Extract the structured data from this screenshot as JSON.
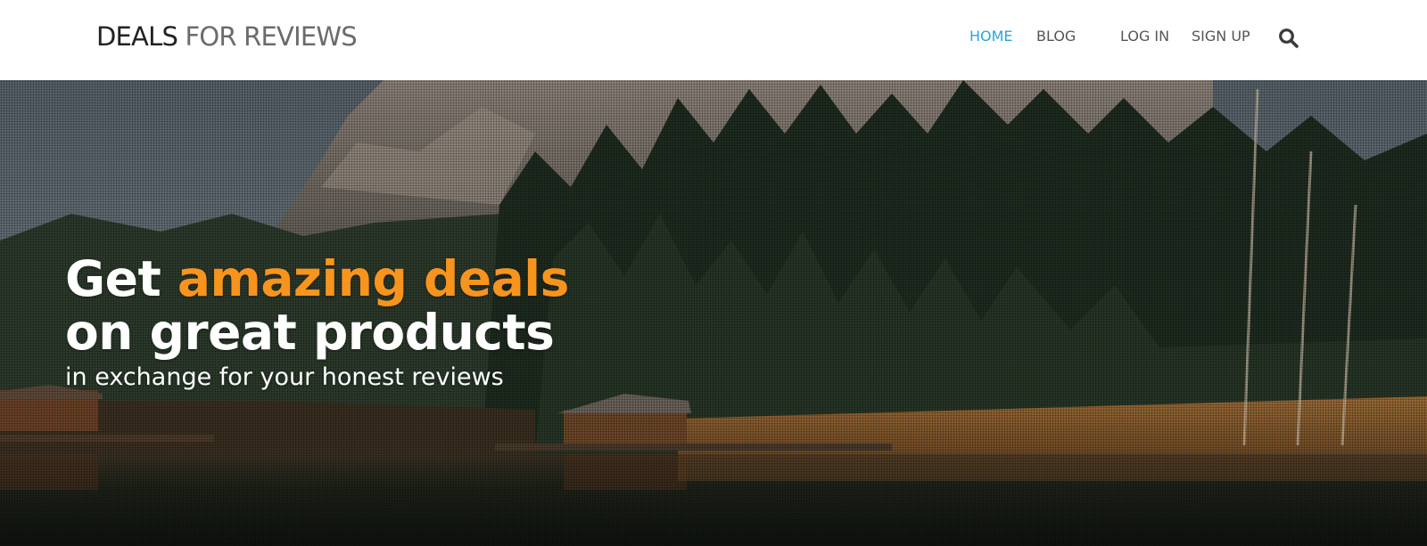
{
  "brand": {
    "part1": "DEALS",
    "part2": "FOR REVIEWS"
  },
  "nav": {
    "home": "HOME",
    "blog": "BLOG",
    "login": "LOG IN",
    "signup": "SIGN UP",
    "search_icon": "search-icon"
  },
  "hero": {
    "line1_prefix": "Get ",
    "line1_highlight": "amazing deals",
    "line2": "on great products",
    "subline": "in exchange for your honest reviews",
    "background": "forest lake with mountain and boathouses"
  },
  "colors": {
    "accent": "#2aa5d8",
    "highlight": "#f7941e",
    "nav_text": "#555555"
  }
}
